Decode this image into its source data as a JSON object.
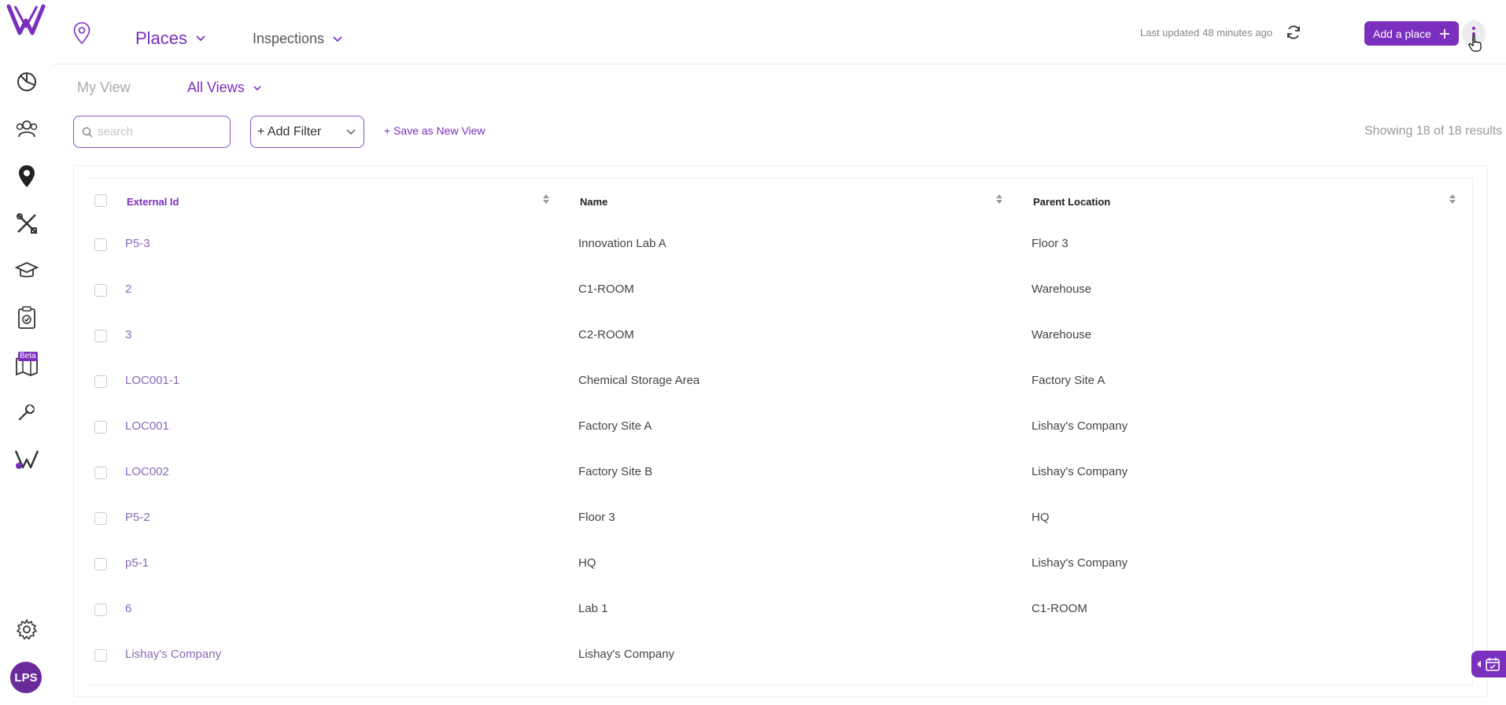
{
  "app": {
    "brand_color": "#7b2fbe",
    "user_initials": "LPS",
    "beta_label": "Beta"
  },
  "sidebar": {
    "items": [
      {
        "icon": "dashboard-pie-icon"
      },
      {
        "icon": "people-icon"
      },
      {
        "icon": "map-pin-icon"
      },
      {
        "icon": "tools-icon"
      },
      {
        "icon": "graduation-cap-icon"
      },
      {
        "icon": "clipboard-check-icon"
      },
      {
        "icon": "map-icon"
      },
      {
        "icon": "wrench-icon"
      },
      {
        "icon": "brand-v-icon"
      },
      {
        "icon": "gear-icon"
      }
    ]
  },
  "header": {
    "tabs": [
      {
        "label": "Places",
        "active": true
      },
      {
        "label": "Inspections",
        "active": false
      }
    ],
    "last_updated_label": "Last updated",
    "last_updated_value": "48 minutes ago",
    "add_button_label": "Add a place"
  },
  "views": {
    "my_view_label": "My View",
    "all_views_label": "All Views"
  },
  "filters": {
    "search_placeholder": "search",
    "add_filter_label": "+ Add Filter",
    "save_view_label": "+ Save as New View",
    "results_text": "Showing 18 of 18 results"
  },
  "table": {
    "columns": [
      "External Id",
      "Name",
      "Parent Location"
    ],
    "rows": [
      {
        "external_id": "P5-3",
        "name": "Innovation Lab A",
        "parent": "Floor 3"
      },
      {
        "external_id": "2",
        "name": "C1-ROOM",
        "parent": "Warehouse"
      },
      {
        "external_id": "3",
        "name": "C2-ROOM",
        "parent": "Warehouse"
      },
      {
        "external_id": "LOC001-1",
        "name": "Chemical Storage Area",
        "parent": "Factory Site A"
      },
      {
        "external_id": "LOC001",
        "name": "Factory Site A",
        "parent": "Lishay's Company"
      },
      {
        "external_id": "LOC002",
        "name": "Factory Site B",
        "parent": "Lishay's Company"
      },
      {
        "external_id": "P5-2",
        "name": "Floor 3",
        "parent": "HQ"
      },
      {
        "external_id": "p5-1",
        "name": "HQ",
        "parent": "Lishay's Company"
      },
      {
        "external_id": "6",
        "name": "Lab 1",
        "parent": "C1-ROOM"
      },
      {
        "external_id": "Lishay's Company",
        "name": "Lishay's Company",
        "parent": ""
      }
    ]
  }
}
